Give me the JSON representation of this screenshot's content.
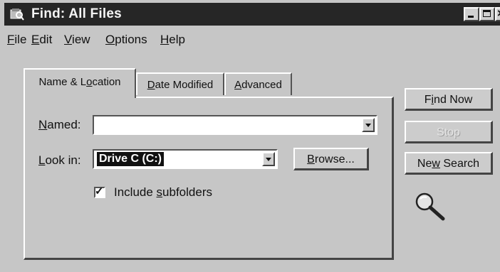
{
  "window": {
    "title": "Find: All Files"
  },
  "menu": [
    {
      "underline": "F",
      "rest": "ile"
    },
    {
      "underline": "E",
      "rest": "dit"
    },
    {
      "underline": "V",
      "rest": "iew"
    },
    {
      "underline": "O",
      "rest": "ptions"
    },
    {
      "underline": "H",
      "rest": "elp"
    }
  ],
  "tabs": {
    "name_location": {
      "pre": "Name & L",
      "ul": "o",
      "post": "cation"
    },
    "date_modified": {
      "pre": "",
      "ul": "D",
      "post": "ate Modified"
    },
    "advanced": {
      "pre": "",
      "ul": "A",
      "post": "dvanced"
    },
    "active": "Name & Location"
  },
  "form": {
    "named": {
      "label_ul": "N",
      "label_rest": "amed:",
      "value": ""
    },
    "look_in": {
      "label_ul": "L",
      "label_rest": "ook in:",
      "value": "Drive C (C:)"
    },
    "browse": {
      "ul": "B",
      "rest": "rowse..."
    },
    "include_subfolders": {
      "pre": "Include ",
      "ul": "s",
      "post": "ubfolders",
      "checked": true
    }
  },
  "buttons": {
    "find_now": {
      "pre": "F",
      "ul": "i",
      "post": "nd Now"
    },
    "stop": {
      "label": "Stop",
      "enabled": false
    },
    "new_search": {
      "pre": "Ne",
      "ul": "w",
      "post": " Search"
    }
  },
  "icons": [
    "find-window-icon",
    "minimize-icon",
    "maximize-icon",
    "close-icon",
    "dropdown-arrow-icon",
    "checkmark-icon",
    "magnifier-icon"
  ],
  "colors": {
    "titlebar": "#262626",
    "face": "#c6c6c6",
    "selection": "#111111"
  }
}
